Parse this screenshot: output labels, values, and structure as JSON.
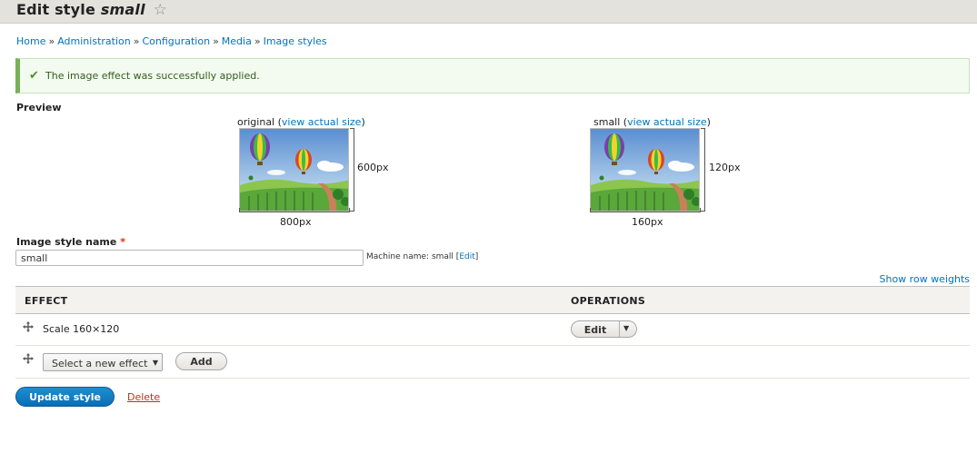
{
  "page": {
    "title_prefix": "Edit style",
    "title_name": "small",
    "star_icon": "star-outline-icon"
  },
  "breadcrumb": {
    "items": [
      "Home",
      "Administration",
      "Configuration",
      "Media",
      "Image styles"
    ],
    "separator": "»"
  },
  "status": {
    "icon": "check-icon",
    "text": "The image effect was successfully applied.",
    "color": "#77b259"
  },
  "preview": {
    "label": "Preview",
    "original": {
      "name": "original",
      "link": "view actual size",
      "height_label": "600px",
      "width_label": "800px"
    },
    "derived": {
      "name": "small",
      "link": "view actual size",
      "height_label": "120px",
      "width_label": "160px"
    }
  },
  "form": {
    "name_label": "Image style name",
    "required_mark": "*",
    "name_value": "small",
    "machine_prefix": "Machine name: small",
    "machine_edit": "Edit"
  },
  "effects": {
    "show_row_weights": "Show row weights",
    "headers": [
      "EFFECT",
      "OPERATIONS"
    ],
    "rows": [
      {
        "effect": "Scale 160×120",
        "operation": "Edit"
      }
    ],
    "new_effect_select": "Select a new effect",
    "add_label": "Add"
  },
  "actions": {
    "update": "Update style",
    "delete": "Delete"
  },
  "colors": {
    "accent": "#0074bd",
    "primary_button": "#0a6db5",
    "danger_link": "#c0301a",
    "header_bg": "#e4e2dc"
  }
}
